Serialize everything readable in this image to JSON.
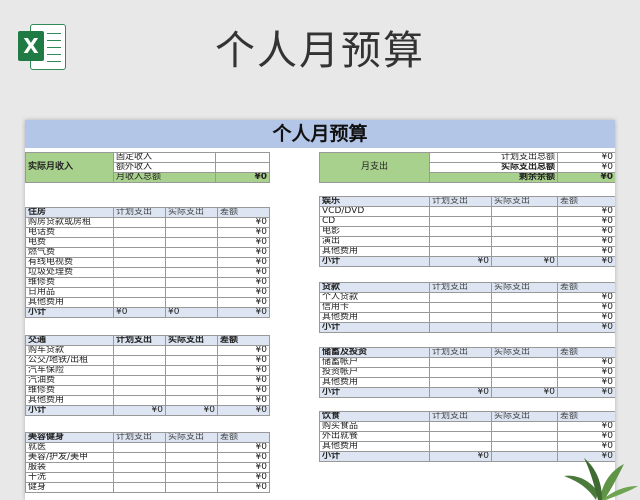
{
  "page": {
    "title": "个人月预算"
  },
  "sheet": {
    "banner": "个人月预算",
    "income": {
      "label": "实际月收入",
      "rows": [
        {
          "label": "固定收入",
          "value": ""
        },
        {
          "label": "额外收入",
          "value": ""
        },
        {
          "label": "月收入总额",
          "value": "¥0"
        }
      ]
    },
    "expense_summary": {
      "label": "月支出",
      "rows": [
        {
          "label": "计划支出总额",
          "value": "¥0"
        },
        {
          "label": "实际支出总额",
          "value": "¥0"
        },
        {
          "label": "剩余余额",
          "value": "¥0"
        }
      ]
    },
    "columns": {
      "plan": "计划支出",
      "actual": "实际支出",
      "diff": "差额"
    },
    "housing": {
      "title": "住房",
      "items": [
        {
          "name": "购房贷款或房租",
          "diff": "¥0"
        },
        {
          "name": "电话费",
          "diff": "¥0"
        },
        {
          "name": "电费",
          "diff": "¥0"
        },
        {
          "name": "燃气费",
          "diff": "¥0"
        },
        {
          "name": "有线电视费",
          "diff": "¥0"
        },
        {
          "name": "垃圾处理费",
          "diff": "¥0"
        },
        {
          "name": "维修费",
          "diff": "¥0"
        },
        {
          "name": "日用品",
          "diff": "¥0"
        },
        {
          "name": "其他费用",
          "diff": "¥0"
        }
      ],
      "subtotal": {
        "label": "小计",
        "plan": "¥0",
        "actual": "¥0",
        "diff": "¥0"
      }
    },
    "transport": {
      "title": "交通",
      "items": [
        {
          "name": "购车贷款",
          "diff": "¥0"
        },
        {
          "name": "公交/地铁/出租",
          "diff": "¥0"
        },
        {
          "name": "汽车保险",
          "diff": "¥0"
        },
        {
          "name": "汽油费",
          "diff": "¥0"
        },
        {
          "name": "维修费",
          "diff": "¥0"
        },
        {
          "name": "其他费用",
          "diff": "¥0"
        }
      ],
      "subtotal": {
        "label": "小计",
        "plan": "¥0",
        "actual": "¥0",
        "diff": "¥0"
      }
    },
    "beauty": {
      "title": "美容健身",
      "items": [
        {
          "name": "就医",
          "diff": "¥0"
        },
        {
          "name": "美容/护发/美甲",
          "diff": "¥0"
        },
        {
          "name": "服装",
          "diff": "¥0"
        },
        {
          "name": "干洗",
          "diff": "¥0"
        },
        {
          "name": "健身",
          "diff": "¥0"
        }
      ]
    },
    "entertainment": {
      "title": "娱乐",
      "items": [
        {
          "name": "VCD/DVD",
          "diff": "¥0"
        },
        {
          "name": "CD",
          "diff": "¥0"
        },
        {
          "name": "电影",
          "diff": "¥0"
        },
        {
          "name": "演出",
          "diff": "¥0"
        },
        {
          "name": "其他费用",
          "diff": "¥0"
        }
      ],
      "subtotal": {
        "label": "小计",
        "plan": "¥0",
        "actual": "¥0",
        "diff": "¥0"
      }
    },
    "loans": {
      "title": "贷款",
      "items": [
        {
          "name": "个人贷款",
          "diff": "¥0"
        },
        {
          "name": "信用卡",
          "diff": "¥0"
        },
        {
          "name": "其他费用",
          "diff": "¥0"
        }
      ],
      "subtotal": {
        "label": "小计",
        "plan": "",
        "actual": "",
        "diff": "¥0"
      }
    },
    "savings": {
      "title": "储蓄及投资",
      "items": [
        {
          "name": "储蓄帐户",
          "diff": "¥0"
        },
        {
          "name": "投资帐户",
          "diff": "¥0"
        },
        {
          "name": "其他费用",
          "diff": "¥0"
        }
      ],
      "subtotal": {
        "label": "小计",
        "plan": "¥0",
        "actual": "¥0",
        "diff": "¥0"
      }
    },
    "food": {
      "title": "饮食",
      "items": [
        {
          "name": "购买食品",
          "diff": "¥0"
        },
        {
          "name": "外出就餐",
          "diff": "¥0"
        },
        {
          "name": "其他费用",
          "diff": "¥0"
        }
      ],
      "subtotal": {
        "label": "小计",
        "plan": "¥0",
        "actual": "",
        "diff": "¥0"
      }
    }
  }
}
